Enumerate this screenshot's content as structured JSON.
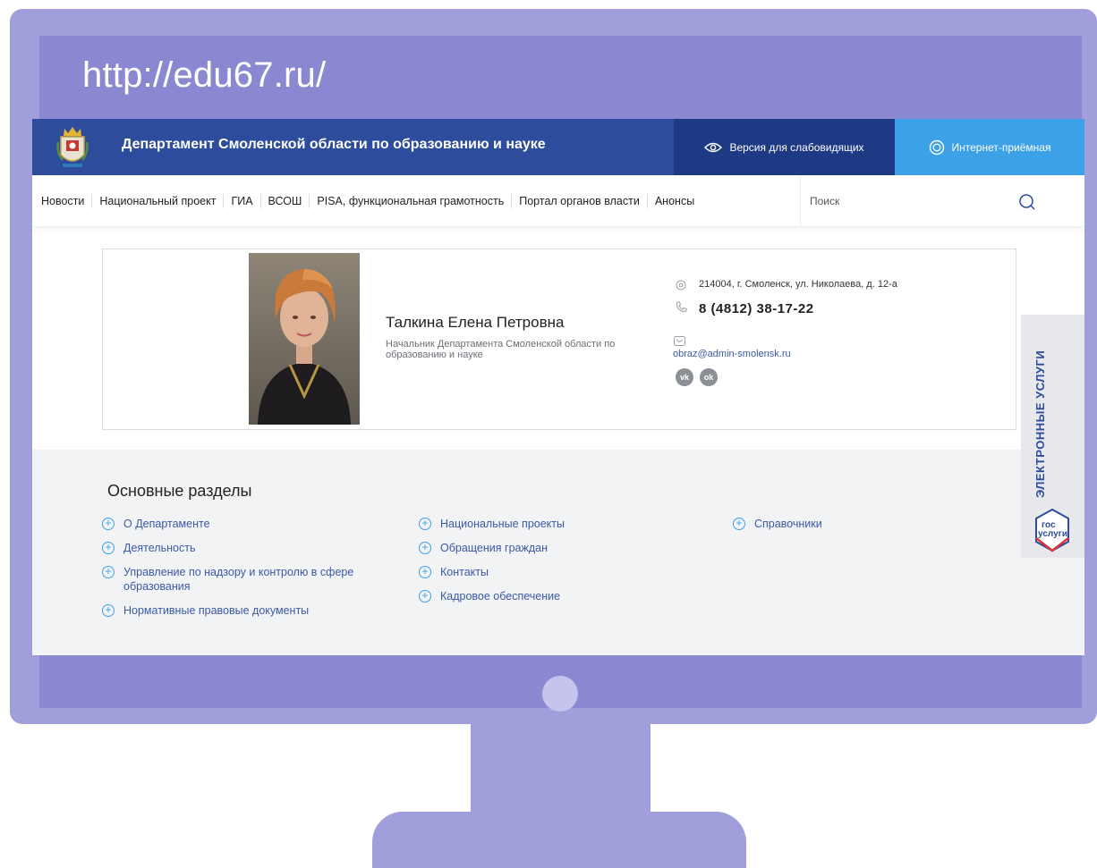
{
  "frame": {
    "url_text": "http://edu67.ru/"
  },
  "header": {
    "title": "Департамент Смоленской области по образованию и науке",
    "low_vision_label": "Версия для слабовидящих",
    "reception_label": "Интернет-приёмная"
  },
  "nav": {
    "items": [
      "Новости",
      "Национальный проект",
      "ГИА",
      "ВСОШ",
      "PISA, функциональная грамотность",
      "Портал органов власти",
      "Анонсы"
    ],
    "search_placeholder": "Поиск"
  },
  "contact": {
    "name": "Талкина Елена Петровна",
    "role": "Начальник Департамента Смоленской области по образованию и науке",
    "address": "214004, г. Смоленск, ул. Николаева, д. 12-а",
    "phone": "8 (4812) 38-17-22",
    "email": "obraz@admin-smolensk.ru",
    "social": [
      "vk",
      "ok"
    ]
  },
  "sections": {
    "title": "Основные разделы",
    "columns": [
      [
        "О Департаменте",
        "Деятельность",
        "Управление по надзору и контролю в сфере образования",
        "Нормативные правовые документы"
      ],
      [
        "Национальные проекты",
        "Обращения граждан",
        "Контакты",
        "Кадровое обеспечение"
      ],
      [
        "Справочники"
      ]
    ]
  },
  "side_widget": {
    "label": "ЭЛЕКТРОННЫЕ УСЛУГИ",
    "logo_line1": "гос",
    "logo_line2": "услуги"
  },
  "colors": {
    "frame": "#a19fdb",
    "header": "#2d4c9b",
    "accent": "#3ca1e6",
    "link": "#3a59a6"
  }
}
